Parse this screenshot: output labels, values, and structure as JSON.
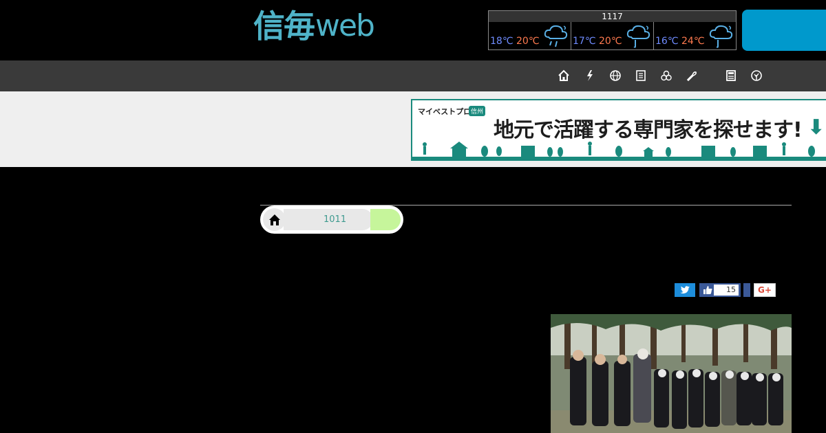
{
  "header": {
    "logo_kanji": "信毎",
    "logo_web": "web"
  },
  "weather": {
    "date": "1117",
    "days": [
      {
        "low": "18℃",
        "high": "20℃",
        "icon": "rain-cloud-icon"
      },
      {
        "low": "17℃",
        "high": "20℃",
        "icon": "rain-cloud-icon"
      },
      {
        "low": "16℃",
        "high": "24℃",
        "icon": "rain-cloud-icon"
      }
    ],
    "colors": {
      "low": "#6f8cff",
      "high": "#ff7a4f"
    }
  },
  "nav": {
    "icons": [
      "home-icon",
      "sports-icon",
      "world-icon",
      "news-icon",
      "community-icon",
      "food-icon",
      "paper-icon",
      "tree-icon"
    ]
  },
  "ad": {
    "brand": "マイベストプロ",
    "tag": "信州",
    "headline": "地元で活躍する専門家を探せます!",
    "arrow": "⬇"
  },
  "breadcrumb": {
    "number": "1011"
  },
  "social": {
    "twitter_icon": "twitter-icon",
    "like_count": "15",
    "gplus_label": "G+"
  },
  "colors": {
    "brand": "#4fb3c8",
    "accent": "#0099cc",
    "ad_green": "#1a8a7d"
  }
}
